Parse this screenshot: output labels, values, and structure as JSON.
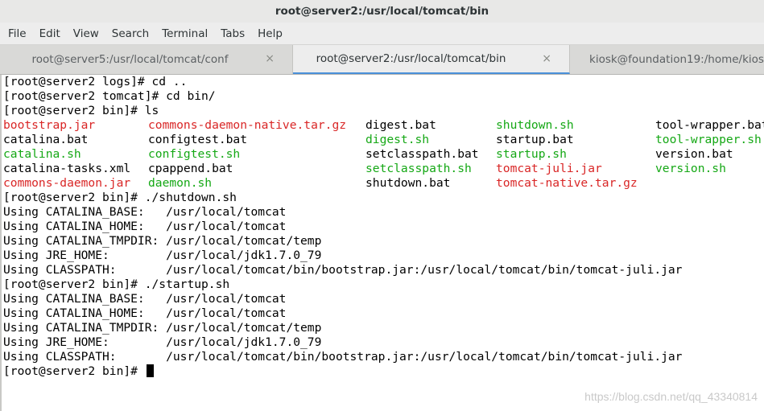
{
  "window": {
    "title": "root@server2:/usr/local/tomcat/bin"
  },
  "menu": [
    "File",
    "Edit",
    "View",
    "Search",
    "Terminal",
    "Tabs",
    "Help"
  ],
  "tabs": [
    {
      "label": "root@server5:/usr/local/tomcat/conf",
      "close": "×"
    },
    {
      "label": "root@server2:/usr/local/tomcat/bin",
      "close": "×"
    },
    {
      "label": "kiosk@foundation19:/home/kios",
      "close": ""
    }
  ],
  "terminal": {
    "lines_before": [
      "[root@server2 logs]# cd ..",
      "[root@server2 tomcat]# cd bin/",
      "[root@server2 bin]# ls"
    ],
    "ls_rows": [
      [
        {
          "name": "bootstrap.jar",
          "color": "#d92626"
        },
        {
          "name": "commons-daemon-native.tar.gz",
          "color": "#d92626"
        },
        {
          "name": "digest.bat",
          "color": "#000000"
        },
        {
          "name": "shutdown.sh",
          "color": "#15a815"
        },
        {
          "name": "tool-wrapper.bat",
          "color": "#000000"
        }
      ],
      [
        {
          "name": "catalina.bat",
          "color": "#000000"
        },
        {
          "name": "configtest.bat",
          "color": "#000000"
        },
        {
          "name": "digest.sh",
          "color": "#15a815"
        },
        {
          "name": "startup.bat",
          "color": "#000000"
        },
        {
          "name": "tool-wrapper.sh",
          "color": "#15a815"
        }
      ],
      [
        {
          "name": "catalina.sh",
          "color": "#15a815"
        },
        {
          "name": "configtest.sh",
          "color": "#15a815"
        },
        {
          "name": "setclasspath.bat",
          "color": "#000000"
        },
        {
          "name": "startup.sh",
          "color": "#15a815"
        },
        {
          "name": "version.bat",
          "color": "#000000"
        }
      ],
      [
        {
          "name": "catalina-tasks.xml",
          "color": "#000000"
        },
        {
          "name": "cpappend.bat",
          "color": "#000000"
        },
        {
          "name": "setclasspath.sh",
          "color": "#15a815"
        },
        {
          "name": "tomcat-juli.jar",
          "color": "#d92626"
        },
        {
          "name": "version.sh",
          "color": "#15a815"
        }
      ],
      [
        {
          "name": "commons-daemon.jar",
          "color": "#d92626"
        },
        {
          "name": "daemon.sh",
          "color": "#15a815"
        },
        {
          "name": "shutdown.bat",
          "color": "#000000"
        },
        {
          "name": "tomcat-native.tar.gz",
          "color": "#d92626"
        },
        {
          "name": "",
          "color": "#000000"
        }
      ]
    ],
    "lines_after": [
      "[root@server2 bin]# ./shutdown.sh",
      "Using CATALINA_BASE:   /usr/local/tomcat",
      "Using CATALINA_HOME:   /usr/local/tomcat",
      "Using CATALINA_TMPDIR: /usr/local/tomcat/temp",
      "Using JRE_HOME:        /usr/local/jdk1.7.0_79",
      "Using CLASSPATH:       /usr/local/tomcat/bin/bootstrap.jar:/usr/local/tomcat/bin/tomcat-juli.jar",
      "[root@server2 bin]# ./startup.sh",
      "Using CATALINA_BASE:   /usr/local/tomcat",
      "Using CATALINA_HOME:   /usr/local/tomcat",
      "Using CATALINA_TMPDIR: /usr/local/tomcat/temp",
      "Using JRE_HOME:        /usr/local/jdk1.7.0_79",
      "Using CLASSPATH:       /usr/local/tomcat/bin/bootstrap.jar:/usr/local/tomcat/bin/tomcat-juli.jar"
    ],
    "prompt": "[root@server2 bin]# "
  },
  "watermark": "https://blog.csdn.net/qq_43340814",
  "colors": {
    "red": "#d92626",
    "green": "#15a815",
    "accent": "#4a90d9"
  }
}
